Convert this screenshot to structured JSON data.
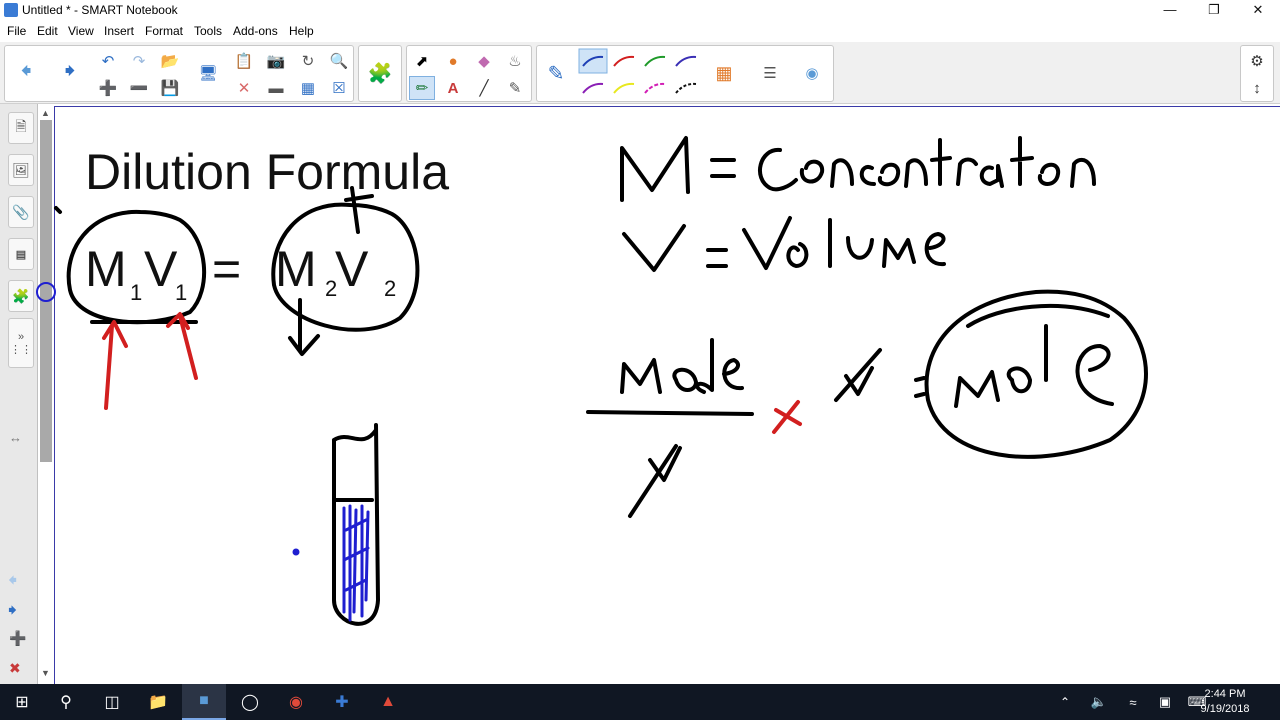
{
  "window": {
    "title": "Untitled * - SMART Notebook",
    "minimize": "—",
    "restore": "❐",
    "close": "✕"
  },
  "menu": [
    "File",
    "Edit",
    "View",
    "Insert",
    "Format",
    "Tools",
    "Add-ons",
    "Help"
  ],
  "toolbar": {
    "icons": [
      "back-arrow-icon",
      "forward-arrow-icon",
      "undo-icon",
      "redo-icon",
      "open-icon",
      "new-page-icon",
      "delete-page-icon",
      "save-icon",
      "screen-shade-icon",
      "paste-icon",
      "delete-icon",
      "screen-capture-icon",
      "table-icon",
      "fullscreen-icon",
      "add-ons-icon",
      "select-icon",
      "shapes-icon",
      "eraser-icon",
      "fill-icon",
      "creative-pen-icon",
      "text-icon",
      "line-icon",
      "magic-pen-icon",
      "pen-icon",
      "color-palette-icon",
      "line-style-icon",
      "properties-icon",
      "settings-icon",
      "toolbar-position-icon"
    ],
    "colors": {
      "blue": "#1f3fb5",
      "red": "#d21f1f",
      "green": "#1f9a2a",
      "purple": "#8a1fb5",
      "yellow": "#e8e81f",
      "magenta": "#d21fb5",
      "black": "#111111"
    }
  },
  "sidebar": {
    "tabs": [
      "page-sorter-icon",
      "gallery-icon",
      "attachments-icon",
      "properties-icon",
      "add-ons-icon"
    ],
    "expand": "»",
    "resize": "↔"
  },
  "canvas": {
    "title": "Dilution Formula",
    "equation": {
      "m1": "M",
      "v1": "V",
      "sub1a": "1",
      "sub1b": "1",
      "equals": "=",
      "m2": "M",
      "v2": "V",
      "sub2a": "2",
      "sub2b": "2"
    },
    "handwriting": [
      "M = Concentration",
      "V = Volume",
      "mole / V",
      "x V = mole"
    ]
  },
  "taskbar": {
    "items": [
      "windows-start-icon",
      "search-icon",
      "task-view-icon",
      "file-explorer-icon",
      "smart-notebook-icon",
      "cortana-icon",
      "chrome-icon",
      "app-icon",
      "acrobat-icon"
    ],
    "time": "2:44 PM",
    "date": "9/19/2018"
  }
}
